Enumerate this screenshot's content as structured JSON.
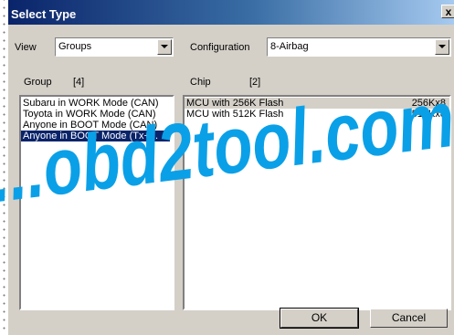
{
  "dialog": {
    "title": "Select Type",
    "close_label": "x"
  },
  "view": {
    "label": "View",
    "selected": "Groups"
  },
  "configuration": {
    "label": "Configuration",
    "selected": "8-Airbag"
  },
  "group": {
    "label": "Group",
    "count": "[4]",
    "items": [
      "Subaru in WORK Mode (CAN)",
      "Toyota in WORK Mode (CAN)",
      "Anyone in BOOT Mode (CAN)",
      "Anyone in BOOT Mode (Tx+..."
    ],
    "selected_index": 3
  },
  "chip": {
    "label": "Chip",
    "count": "[2]",
    "items": [
      {
        "name": "MCU with 256K Flash",
        "size": "256Kx8"
      },
      {
        "name": "MCU with 512K Flash",
        "size": "512Kx8"
      }
    ]
  },
  "buttons": {
    "ok": "OK",
    "cancel": "Cancel"
  },
  "watermark": {
    "text": "...obd2tool.com",
    "color": "#0aa0e8"
  }
}
